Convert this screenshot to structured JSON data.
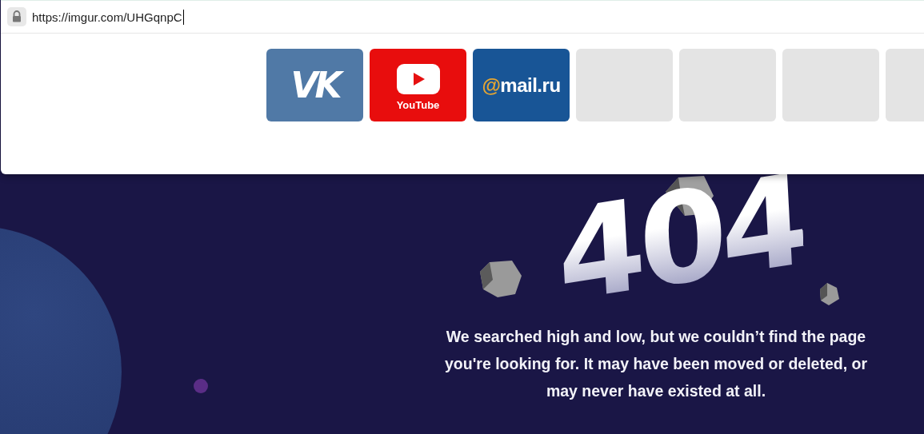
{
  "address_bar": {
    "value": "https://imgur.com/UHGqnpC"
  },
  "speed_dial": [
    {
      "kind": "vk",
      "logo_text": "VK"
    },
    {
      "kind": "youtube",
      "label": "YouTube"
    },
    {
      "kind": "mail",
      "logo_at": "@",
      "logo_text": "mail.ru"
    },
    {
      "kind": "empty"
    },
    {
      "kind": "empty"
    },
    {
      "kind": "empty"
    },
    {
      "kind": "empty"
    }
  ],
  "page": {
    "heading": "404",
    "message": "We searched high and low, but we couldn’t find the page you're looking for. It may have been moved or deleted, or may never have existed at all."
  }
}
